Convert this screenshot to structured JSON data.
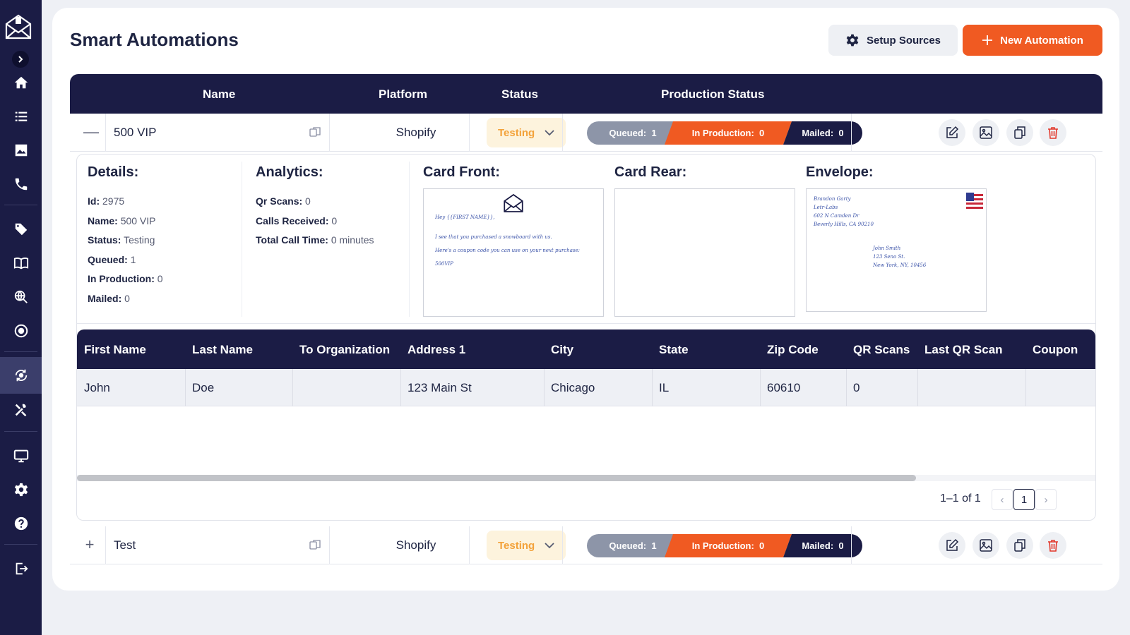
{
  "header": {
    "title": "Smart Automations",
    "setup_sources_label": "Setup Sources",
    "new_automation_label": "New Automation"
  },
  "table": {
    "columns": [
      "Name",
      "Platform",
      "Status",
      "Production Status"
    ]
  },
  "rows": [
    {
      "name": "500 VIP",
      "platform": "Shopify",
      "status": "Testing",
      "queued_label": "Queued:",
      "queued": "1",
      "in_production_label": "In Production:",
      "in_production": "0",
      "mailed_label": "Mailed:",
      "mailed": "0",
      "expanded": true
    },
    {
      "name": "Test",
      "platform": "Shopify",
      "status": "Testing",
      "queued_label": "Queued:",
      "queued": "1",
      "in_production_label": "In Production:",
      "in_production": "0",
      "mailed_label": "Mailed:",
      "mailed": "0",
      "expanded": false
    }
  ],
  "details": {
    "title": "Details:",
    "items": [
      {
        "label": "Id:",
        "value": "2975"
      },
      {
        "label": "Name:",
        "value": "500 VIP"
      },
      {
        "label": "Status:",
        "value": "Testing"
      },
      {
        "label": "Queued:",
        "value": "1"
      },
      {
        "label": "In Production:",
        "value": "0"
      },
      {
        "label": "Mailed:",
        "value": "0"
      }
    ]
  },
  "analytics": {
    "title": "Analytics:",
    "items": [
      {
        "label": "Qr Scans:",
        "value": "0"
      },
      {
        "label": "Calls Received:",
        "value": "0"
      },
      {
        "label": "Total Call Time:",
        "value": "0 minutes"
      }
    ]
  },
  "card_front": {
    "title": "Card Front:",
    "lines": [
      "Hey {{FIRST NAME}},",
      "I see that you purchased a snowboard with us.",
      "Here's a coupon code you can use on your next purchase:",
      "500VIP"
    ]
  },
  "card_rear": {
    "title": "Card Rear:"
  },
  "envelope": {
    "title": "Envelope:",
    "return_address": [
      "Brandon Garty",
      "Letr-Labs",
      "602 N Camden Dr",
      "Beverly Hills, CA 90210"
    ],
    "recipient_address": [
      "John Smith",
      "123 Seno St.",
      "New York, NY, 10456"
    ]
  },
  "recipients": {
    "columns": [
      "First Name",
      "Last Name",
      "To Organization",
      "Address 1",
      "City",
      "State",
      "Zip Code",
      "QR Scans",
      "Last QR Scan",
      "Coupon"
    ],
    "rows": [
      {
        "first_name": "John",
        "last_name": "Doe",
        "organization": "",
        "address1": "123 Main St",
        "city": "Chicago",
        "state": "IL",
        "zip": "60610",
        "qr_scans": "0",
        "last_qr_scan": "",
        "coupon": ""
      }
    ],
    "pagination": {
      "info": "1–1 of 1",
      "page": "1",
      "prev": "‹",
      "next": "›"
    }
  },
  "colors": {
    "sidebar": "#1b1c45",
    "accent": "#f05a22",
    "status_testing_bg": "#fdf3dd",
    "status_testing_text": "#f3a23a",
    "queued": "#8d95a8",
    "mailed": "#1b1c45"
  },
  "sidebar": {
    "icons": [
      "mail-logo-icon",
      "chevron-right-icon",
      "home-icon",
      "list-icon",
      "image-icon",
      "phone-icon",
      "tag-icon",
      "book-icon",
      "search-globe-icon",
      "target-icon",
      "automation-icon",
      "tools-icon",
      "monitor-icon",
      "gear-icon",
      "help-icon",
      "logout-icon"
    ]
  }
}
